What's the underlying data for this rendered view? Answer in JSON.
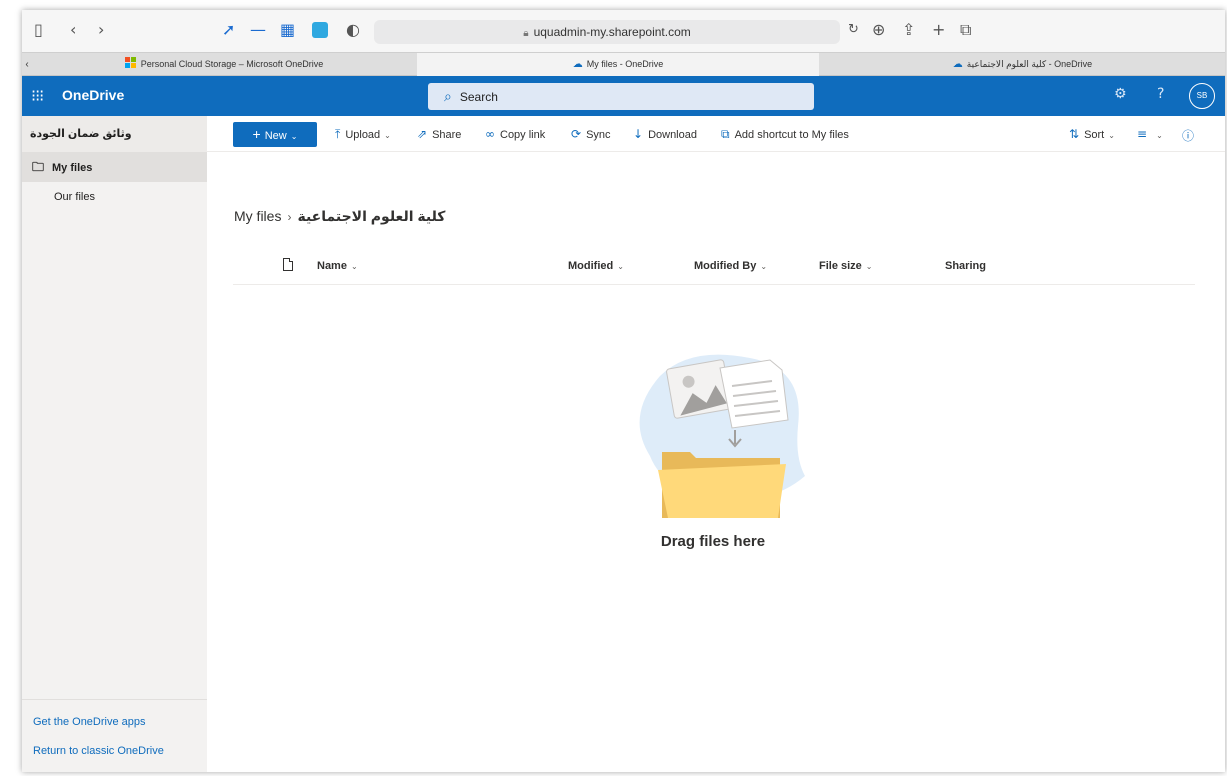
{
  "browser": {
    "url": "uquadmin-my.sharepoint.com",
    "tabs": [
      {
        "title": "Personal Cloud Storage – Microsoft OneDrive",
        "active": false
      },
      {
        "title": "My files - OneDrive",
        "active": true
      },
      {
        "title": "كلية العلوم الاجتماعية - OneDrive",
        "active": false
      }
    ]
  },
  "suite": {
    "app_name": "OneDrive",
    "search_placeholder": "Search",
    "avatar_initials": "SB",
    "help_label": "?"
  },
  "sidebar": {
    "header": "وثائق ضمان الجودة",
    "items": [
      {
        "label": "My files",
        "selected": true,
        "icon": "folder-icon"
      },
      {
        "label": "Our files",
        "selected": false
      }
    ],
    "footer_links": [
      "Get the OneDrive apps",
      "Return to classic OneDrive"
    ]
  },
  "commands": {
    "new": "New",
    "upload": "Upload",
    "share": "Share",
    "copy_link": "Copy link",
    "sync": "Sync",
    "download": "Download",
    "add_shortcut": "Add shortcut to My files",
    "sort": "Sort"
  },
  "breadcrumb": {
    "root": "My files",
    "current": "كلية العلوم الاجتماعية"
  },
  "columns": [
    "Name",
    "Modified",
    "Modified By",
    "File size",
    "Sharing"
  ],
  "empty_state": {
    "message": "Drag files here"
  },
  "colors": {
    "brand": "#0f6cbd",
    "nav_bg": "#f3f2f1",
    "selected_bg": "#e1dfdd"
  }
}
